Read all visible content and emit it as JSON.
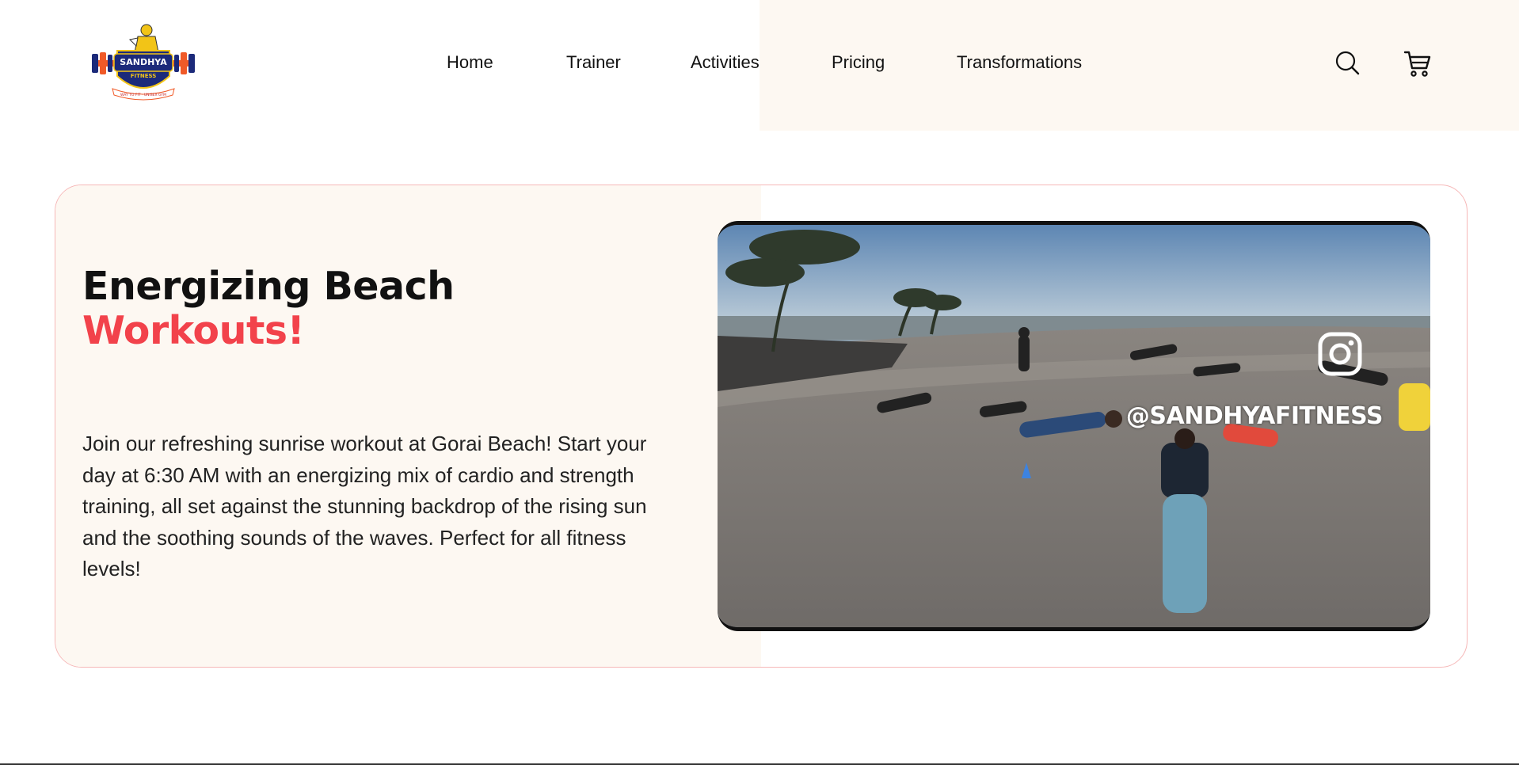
{
  "brand": {
    "logo_name": "SANDHYA",
    "logo_sub": "FITNESS",
    "logo_tagline": "WAY TO FIT · UNISEX GYM"
  },
  "nav": {
    "items": [
      "Home",
      "Trainer",
      "Activities",
      "Pricing",
      "Transformations"
    ]
  },
  "header_icons": [
    "search-icon",
    "cart-icon"
  ],
  "hero": {
    "title_line1": "Energizing Beach",
    "title_line2": "Workouts!",
    "description": "Join our refreshing sunrise workout at Gorai Beach! Start your day at 6:30 AM with an energizing mix of cardio and strength training, all set against the stunning backdrop of the rising sun and the soothing sounds of the waves. Perfect for all fitness levels!",
    "video_overlay_handle": "@SANDHYAFITNESS",
    "video_overlay_icon": "instagram-icon"
  },
  "colors": {
    "accent": "#f2424b",
    "cream": "#fdf8f2",
    "card_border": "#f6b8b8",
    "text": "#111111"
  }
}
